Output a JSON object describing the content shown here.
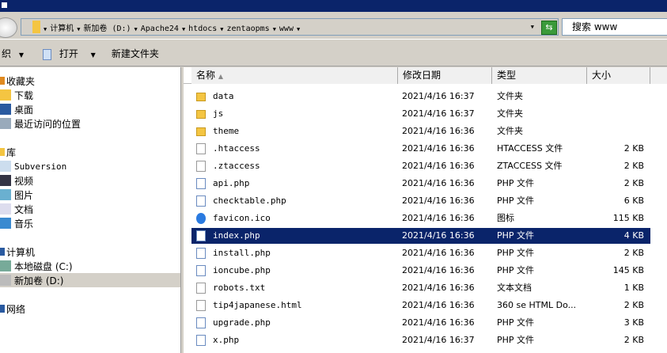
{
  "address": {
    "crumbs": [
      "计算机",
      "新加卷 (D:)",
      "Apache24",
      "htdocs",
      "zentaopms",
      "www"
    ]
  },
  "search": {
    "placeholder": "搜索 www"
  },
  "toolbar": {
    "organize": "织",
    "open": "打开",
    "new_folder": "新建文件夹"
  },
  "sidebar": [
    {
      "label": "收藏夹",
      "icon": "star-icon",
      "top": true
    },
    {
      "label": "下载",
      "icon": "downloads-icon"
    },
    {
      "label": "桌面",
      "icon": "desktop-icon"
    },
    {
      "label": "最近访问的位置",
      "icon": "recent-icon"
    },
    {
      "label": "库",
      "icon": "library-icon",
      "top": true
    },
    {
      "label": "Subversion",
      "icon": "library-doc-icon"
    },
    {
      "label": "视频",
      "icon": "video-icon"
    },
    {
      "label": "图片",
      "icon": "pictures-icon"
    },
    {
      "label": "文档",
      "icon": "documents-icon"
    },
    {
      "label": "音乐",
      "icon": "music-icon"
    },
    {
      "label": "计算机",
      "icon": "computer-icon",
      "top": true
    },
    {
      "label": "本地磁盘 (C:)",
      "icon": "drive-c-icon"
    },
    {
      "label": "新加卷 (D:)",
      "icon": "drive-d-icon",
      "selected": true
    },
    {
      "label": "网络",
      "icon": "network-icon",
      "top": true
    }
  ],
  "columns": {
    "name": "名称",
    "date": "修改日期",
    "type": "类型",
    "size": "大小"
  },
  "files": [
    {
      "name": "data",
      "date": "2021/4/16 16:37",
      "type": "文件夹",
      "size": "",
      "kind": "folder"
    },
    {
      "name": "js",
      "date": "2021/4/16 16:37",
      "type": "文件夹",
      "size": "",
      "kind": "folder"
    },
    {
      "name": "theme",
      "date": "2021/4/16 16:36",
      "type": "文件夹",
      "size": "",
      "kind": "folder"
    },
    {
      "name": ".htaccess",
      "date": "2021/4/16 16:36",
      "type": "HTACCESS 文件",
      "size": "2 KB",
      "kind": "doc"
    },
    {
      "name": ".ztaccess",
      "date": "2021/4/16 16:36",
      "type": "ZTACCESS 文件",
      "size": "2 KB",
      "kind": "doc"
    },
    {
      "name": "api.php",
      "date": "2021/4/16 16:36",
      "type": "PHP 文件",
      "size": "2 KB",
      "kind": "php"
    },
    {
      "name": "checktable.php",
      "date": "2021/4/16 16:36",
      "type": "PHP 文件",
      "size": "6 KB",
      "kind": "php"
    },
    {
      "name": "favicon.ico",
      "date": "2021/4/16 16:36",
      "type": "图标",
      "size": "115 KB",
      "kind": "ico"
    },
    {
      "name": "index.php",
      "date": "2021/4/16 16:36",
      "type": "PHP 文件",
      "size": "4 KB",
      "kind": "php",
      "selected": true
    },
    {
      "name": "install.php",
      "date": "2021/4/16 16:36",
      "type": "PHP 文件",
      "size": "2 KB",
      "kind": "php"
    },
    {
      "name": "ioncube.php",
      "date": "2021/4/16 16:36",
      "type": "PHP 文件",
      "size": "145 KB",
      "kind": "php"
    },
    {
      "name": "robots.txt",
      "date": "2021/4/16 16:36",
      "type": "文本文档",
      "size": "1 KB",
      "kind": "doc"
    },
    {
      "name": "tip4japanese.html",
      "date": "2021/4/16 16:36",
      "type": "360 se HTML Do...",
      "size": "2 KB",
      "kind": "doc"
    },
    {
      "name": "upgrade.php",
      "date": "2021/4/16 16:36",
      "type": "PHP 文件",
      "size": "3 KB",
      "kind": "php"
    },
    {
      "name": "x.php",
      "date": "2021/4/16 16:37",
      "type": "PHP 文件",
      "size": "2 KB",
      "kind": "php"
    }
  ]
}
